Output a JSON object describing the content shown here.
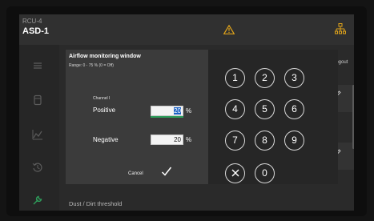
{
  "device": {
    "line1": "RCU-4",
    "line2": "ASD-1"
  },
  "header": {
    "warning_icon": "warning-triangle-icon",
    "network_icon": "network-icon",
    "logout_label": "Logout"
  },
  "sidebar": {
    "icons": [
      "list-icon",
      "device-icon",
      "chart-icon",
      "history-icon",
      "wrench-icon"
    ],
    "active_color": "#2e9e5b"
  },
  "footer": {
    "text": "Dust / Dirt threshold"
  },
  "dialog": {
    "title": "Airflow monitoring window",
    "range": "Range: 0 - 75 % (0 = Off)",
    "channel": "Channel I",
    "positive_label": "Positive",
    "positive_value": "20",
    "positive_unit": "%",
    "negative_label": "Negative",
    "negative_value": "20",
    "negative_unit": "%",
    "cancel_label": "Cancel",
    "confirm_icon": "checkmark-icon"
  },
  "keypad": {
    "keys": [
      "1",
      "2",
      "3",
      "4",
      "5",
      "6",
      "7",
      "8",
      "9",
      "0"
    ],
    "clear_icon": "close-icon"
  },
  "colors": {
    "accent": "#2e9e5b",
    "selection": "#1c62c4",
    "warning": "#e0a31a"
  }
}
